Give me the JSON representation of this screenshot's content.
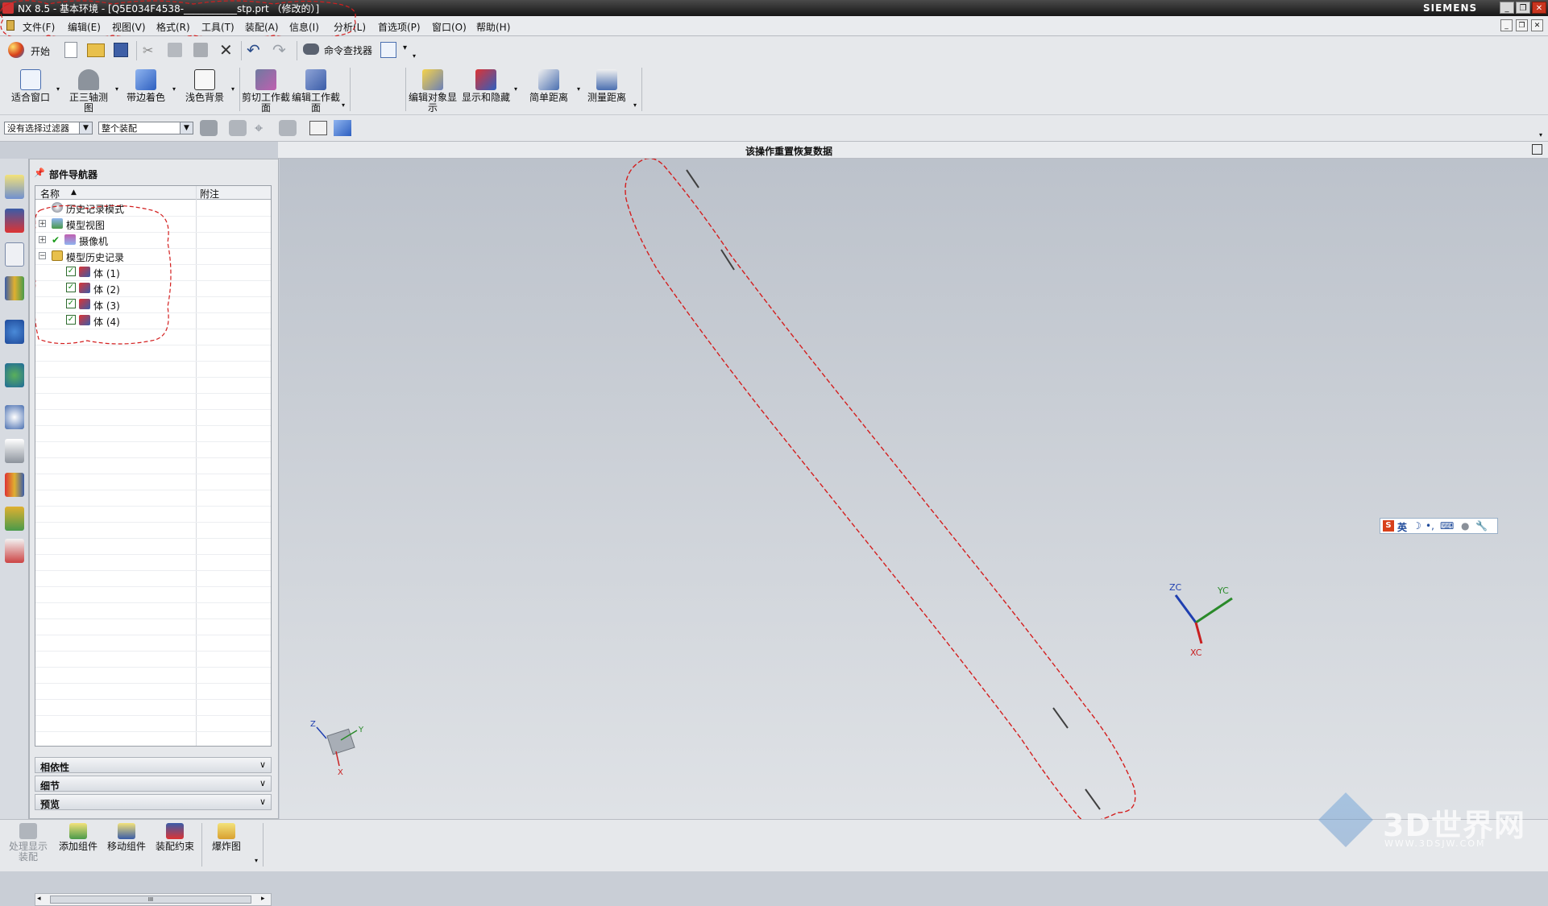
{
  "window": {
    "title": "NX 8.5 - 基本环境 - [Q5E034F4538-___________stp.prt （修改的）]",
    "brand": "SIEMENS",
    "controls": [
      "_",
      "❐",
      "✕"
    ]
  },
  "menu": {
    "items": [
      "文件(F)",
      "编辑(E)",
      "视图(V)",
      "格式(R)",
      "工具(T)",
      "装配(A)",
      "信息(I)",
      "分析(L)",
      "首选项(P)",
      "窗口(O)",
      "帮助(H)"
    ]
  },
  "toolbar_standard": {
    "start_label": "开始",
    "command_finder_label": "命令查找器"
  },
  "toolbar_view": {
    "fit_window": "适合窗口",
    "trimetric": "正三轴测图",
    "shaded_with_edges": "带边着色",
    "light_background": "浅色背景",
    "clip_section": "剪切工作截面",
    "edit_section": "编辑工作截面",
    "edit_object_display": "编辑对象显示",
    "show_hide": "显示和隐藏",
    "simple_distance": "简单距离",
    "measure_distance": "测量距离"
  },
  "selection_bar": {
    "filter_value": "没有选择过滤器",
    "scope_value": "整个装配"
  },
  "status": {
    "message": "该操作重置恢复数据"
  },
  "navigator": {
    "title": "部件导航器",
    "columns": [
      "名称",
      "附注"
    ],
    "items": [
      {
        "label": "历史记录模式"
      },
      {
        "label": "模型视图"
      },
      {
        "label": "摄像机"
      },
      {
        "label": "模型历史记录"
      },
      {
        "label": "体 (1)"
      },
      {
        "label": "体 (2)"
      },
      {
        "label": "体 (3)"
      },
      {
        "label": "体 (4)"
      }
    ],
    "scroll_mark": "III",
    "sections": [
      "相依性",
      "细节",
      "预览"
    ]
  },
  "viewport": {
    "triad": {
      "x": "XC",
      "y": "YC",
      "z": "ZC"
    },
    "view_triad": {
      "x": "X",
      "y": "Y",
      "z": "Z"
    }
  },
  "ime": {
    "lang": "英"
  },
  "assembly_toolbar": {
    "items": [
      "处理显示装配",
      "添加组件",
      "移动组件",
      "装配约束",
      "爆炸图"
    ]
  },
  "watermark": {
    "text": "3D世界网",
    "url": "WWW.3DSJW.COM"
  },
  "colors": {
    "accent": "#d31e1e",
    "titlebar": "#1f1f1f",
    "viewport_top": "#bcc2cb",
    "viewport_bottom": "#dfe2e6"
  }
}
